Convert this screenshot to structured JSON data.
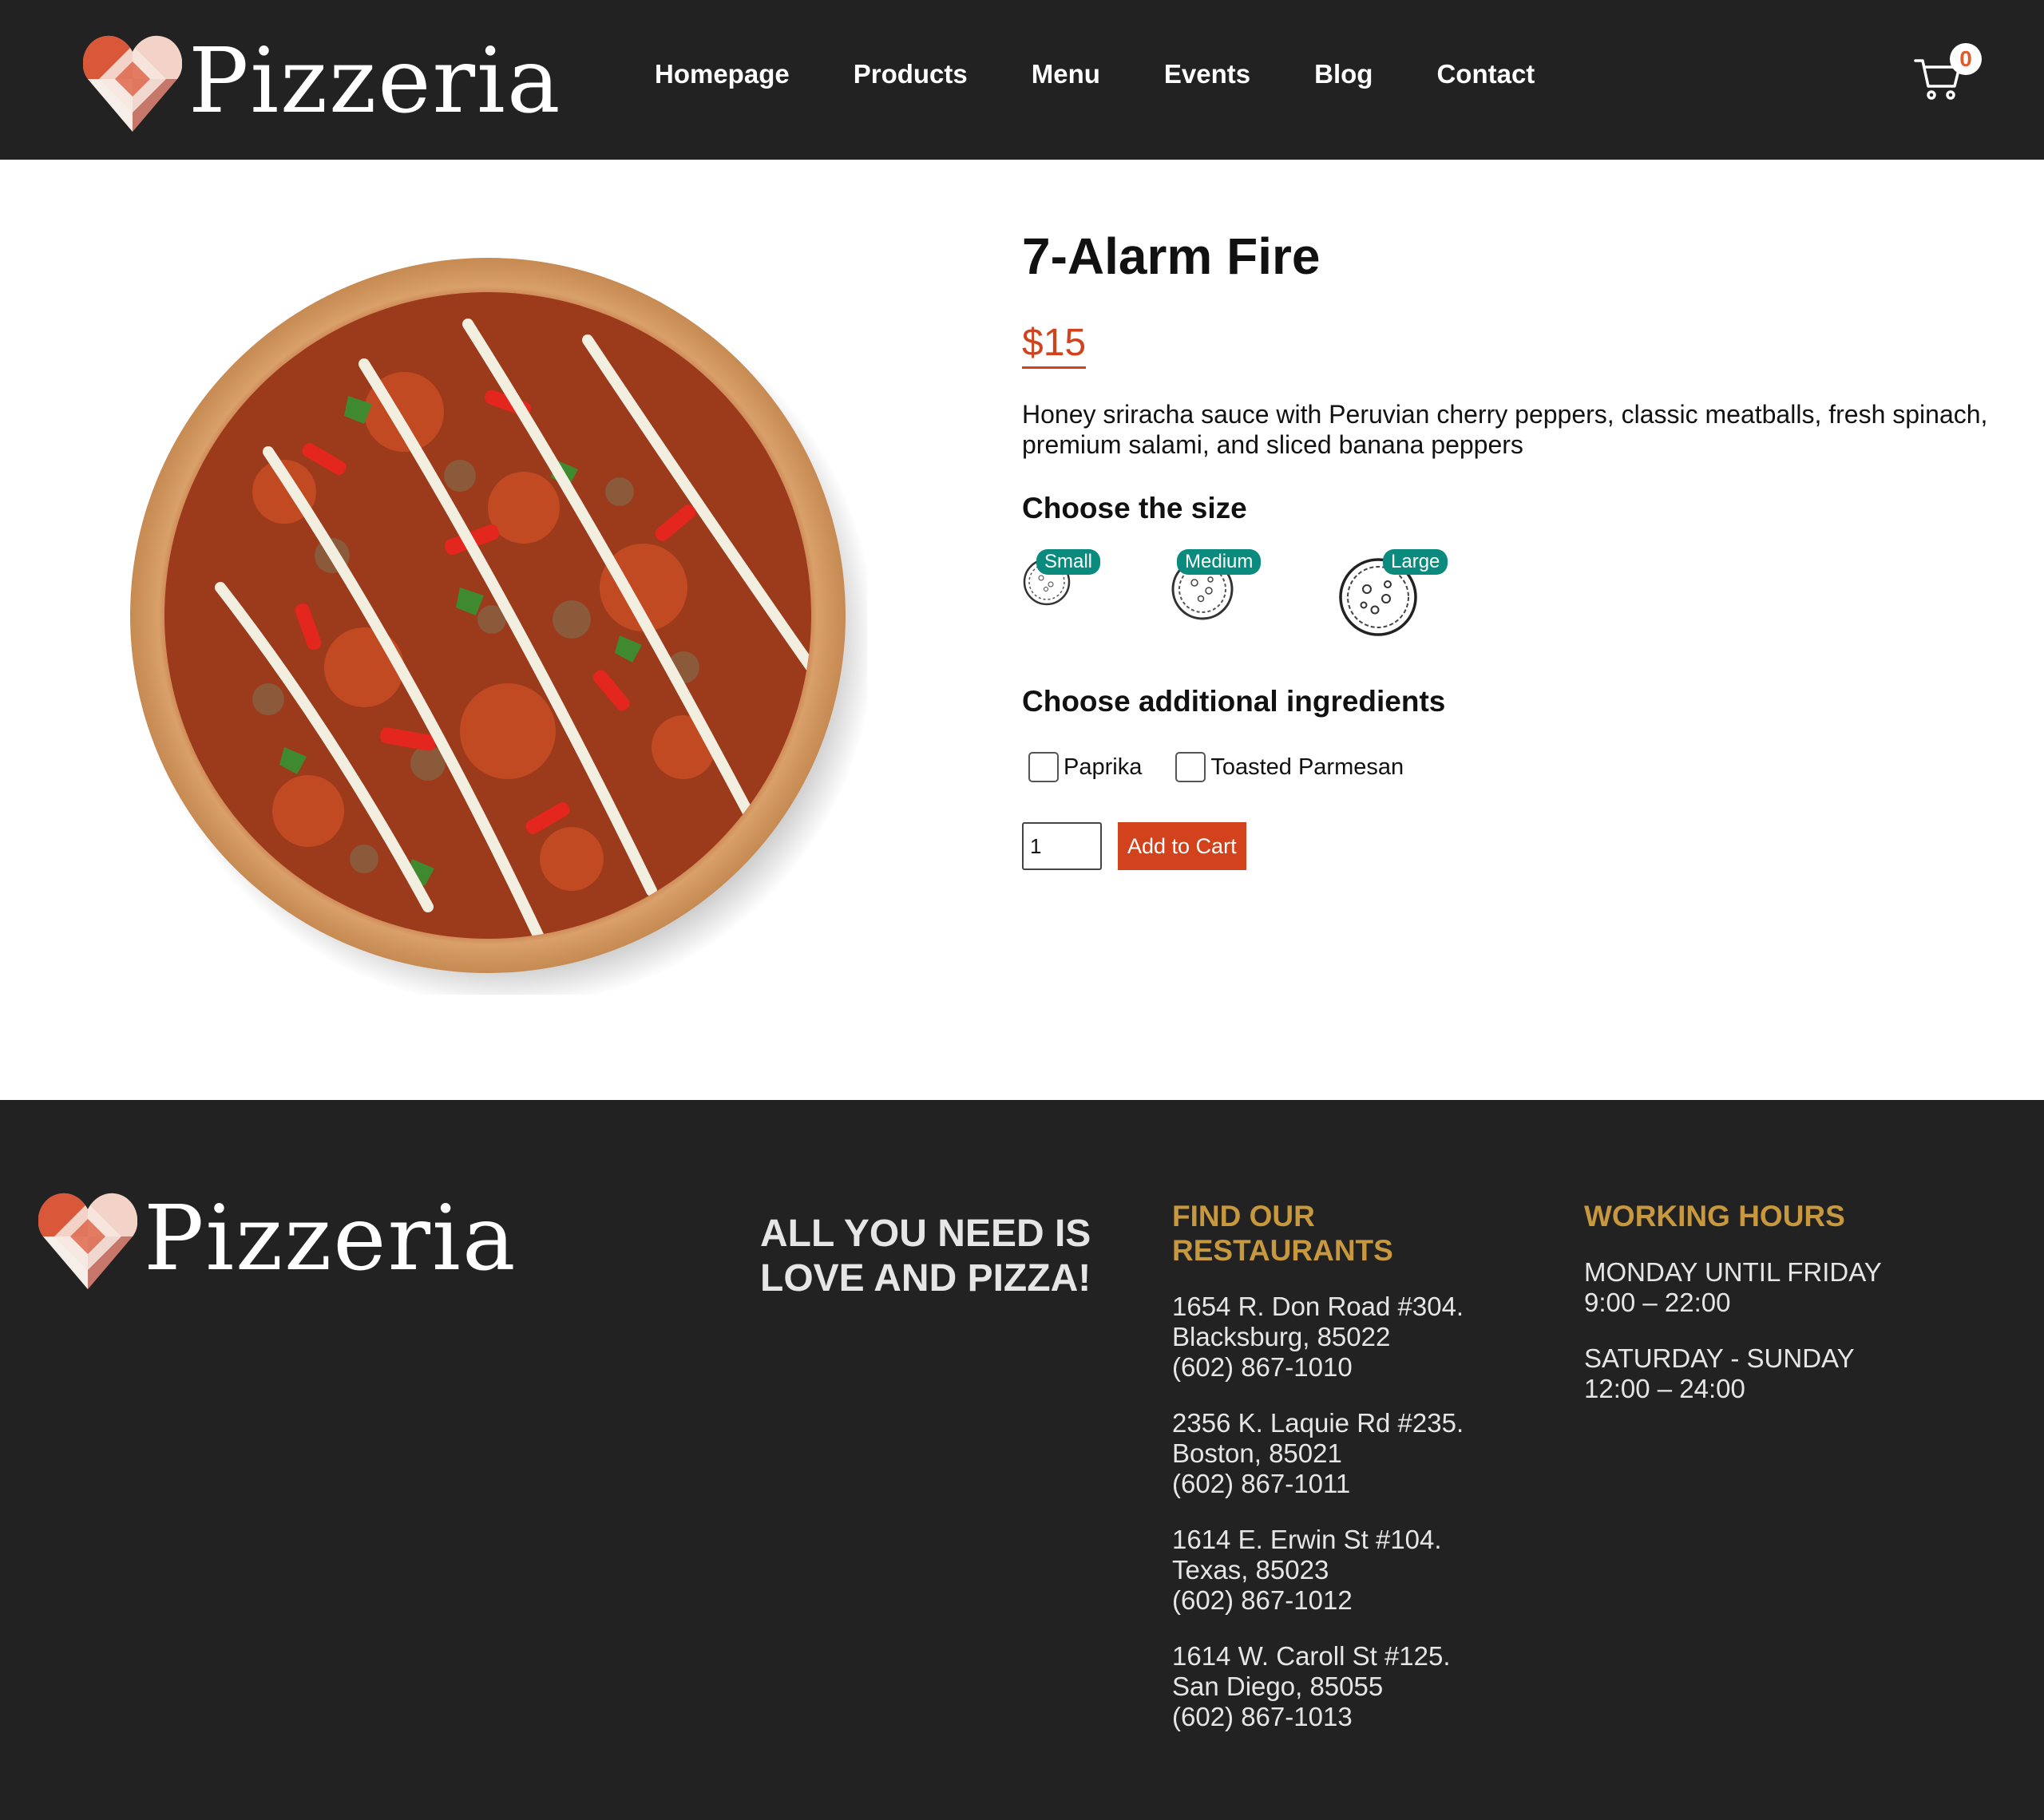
{
  "header": {
    "brand": "Pizzeria",
    "nav": [
      "Homepage",
      "Products",
      "Menu",
      "Events",
      "Blog",
      "Contact"
    ],
    "cart_count": "0"
  },
  "product": {
    "title": "7-Alarm Fire",
    "price": "$15",
    "description": "Honey sriracha sauce with Peruvian cherry peppers, classic meatballs, fresh spinach, premium salami, and sliced banana peppers",
    "size_heading": "Choose the size",
    "sizes": [
      "Small",
      "Medium",
      "Large"
    ],
    "ingredients_heading": "Choose additional ingredients",
    "ingredients": [
      "Paprika",
      "Toasted Parmesan"
    ],
    "quantity": "1",
    "add_to_cart": "Add to Cart"
  },
  "footer": {
    "brand": "Pizzeria",
    "tagline": "ALL YOU NEED IS LOVE AND PIZZA!",
    "restaurants_heading": "FIND OUR RESTAURANTS",
    "restaurants": [
      {
        "street": "1654 R. Don Road #304.",
        "city": "Blacksburg, 85022",
        "phone": "(602) 867-1010"
      },
      {
        "street": "2356 K. Laquie Rd #235.",
        "city": "Boston, 85021",
        "phone": "(602) 867-1011"
      },
      {
        "street": "1614 E. Erwin St #104.",
        "city": "Texas, 85023",
        "phone": "(602) 867-1012"
      },
      {
        "street": "1614 W. Caroll St #125.",
        "city": "San Diego, 85055",
        "phone": "(602) 867-1013"
      }
    ],
    "hours_heading": "WORKING HOURS",
    "hours": [
      {
        "days": "MONDAY UNTIL FRIDAY",
        "time": "9:00 – 22:00"
      },
      {
        "days": "SATURDAY - SUNDAY",
        "time": "12:00 – 24:00"
      }
    ]
  },
  "colors": {
    "dark_bg": "#222222",
    "accent_red": "#d2421c",
    "teal_tag": "#0b8a7e",
    "gold_heading": "#c7983e"
  },
  "icons": [
    "cart-icon",
    "logo-heart-icon",
    "pizza-size-icon"
  ]
}
